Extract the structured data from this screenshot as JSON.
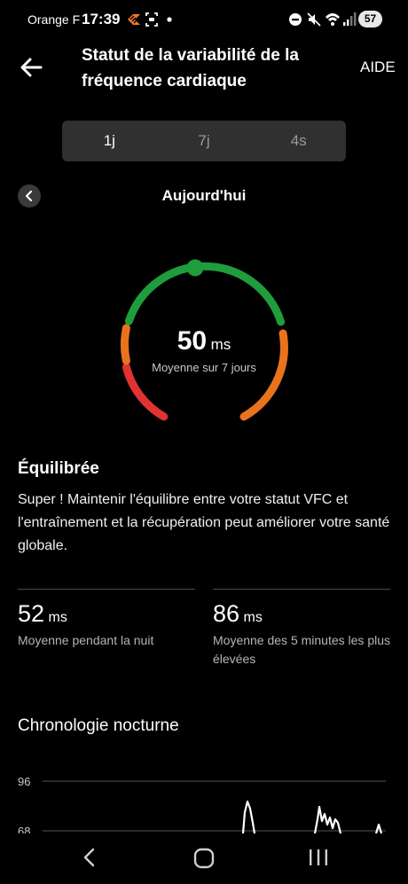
{
  "status_bar": {
    "carrier": "Orange F",
    "time": "17:39",
    "battery": "57",
    "icons": [
      "carrier-logo-icon",
      "screenshot-icon",
      "dot-icon",
      "dnd-icon",
      "mute-icon",
      "wifi-icon",
      "signal-icon",
      "battery-icon"
    ]
  },
  "app_bar": {
    "title": "Statut de la variabilité de la fréquence cardiaque",
    "help_label": "AIDE",
    "back_icon": "back-arrow-icon"
  },
  "period_tabs": [
    {
      "label": "1j",
      "active": true
    },
    {
      "label": "7j",
      "active": false
    },
    {
      "label": "4s",
      "active": false
    }
  ],
  "date_nav": {
    "label": "Aujourd'hui",
    "prev_icon": "chevron-left-icon"
  },
  "gauge": {
    "value": "50",
    "unit": "ms",
    "caption": "Moyenne sur 7 jours",
    "colors": {
      "low": "#e03232",
      "mid": "#e8731c",
      "balanced": "#1f9c3b"
    }
  },
  "status": {
    "heading": "Équilibrée",
    "description": "Super ! Maintenir l'équilibre entre votre statut VFC et l'entraînement et la récupération peut améliorer votre santé globale."
  },
  "stats": [
    {
      "value": "52",
      "unit": "ms",
      "label": "Moyenne pendant la nuit"
    },
    {
      "value": "86",
      "unit": "ms",
      "label": "Moyenne des 5 minutes les plus élevées"
    }
  ],
  "timeline": {
    "title": "Chronologie nocturne",
    "y_ticks": [
      "96",
      "68"
    ]
  },
  "nav_bar": {
    "icons": [
      "nav-back-icon",
      "nav-home-icon",
      "nav-recents-icon"
    ]
  }
}
